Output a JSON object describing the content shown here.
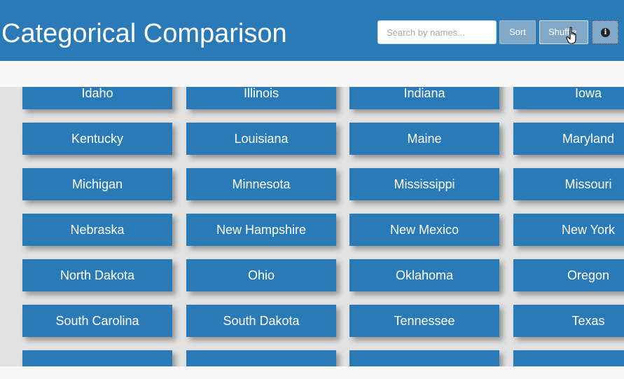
{
  "header": {
    "title": "Categorical Comparison",
    "search_placeholder": "Search by names...",
    "sort_label": "Sort",
    "shuffle_label": "Shuffle",
    "info_glyph": "i"
  },
  "cards": [
    [
      "Idaho",
      "Illinois",
      "Indiana",
      "Iowa"
    ],
    [
      "Kentucky",
      "Louisiana",
      "Maine",
      "Maryland"
    ],
    [
      "Michigan",
      "Minnesota",
      "Mississippi",
      "Missouri"
    ],
    [
      "Nebraska",
      "New Hampshire",
      "New Mexico",
      "New York"
    ],
    [
      "North Dakota",
      "Ohio",
      "Oklahoma",
      "Oregon"
    ],
    [
      "South Carolina",
      "South Dakota",
      "Tennessee",
      "Texas"
    ],
    [
      "",
      "",
      "",
      ""
    ]
  ],
  "colors": {
    "primary": "#2a7ab7",
    "button_muted": "#82a8c8"
  }
}
